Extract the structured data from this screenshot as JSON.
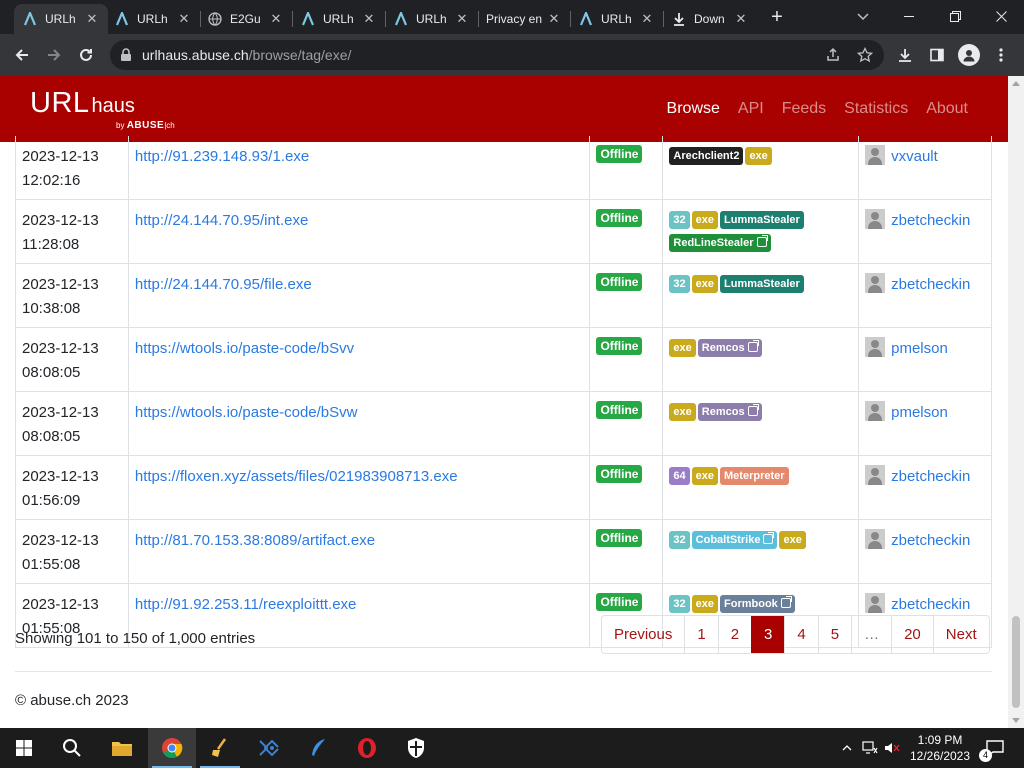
{
  "browser": {
    "tabs": [
      {
        "title": "URLh",
        "active": true
      },
      {
        "title": "URLh",
        "active": false
      },
      {
        "title": "E2Gu",
        "active": false
      },
      {
        "title": "URLh",
        "active": false
      },
      {
        "title": "URLh",
        "active": false
      },
      {
        "title": "Privacy en",
        "active": false
      },
      {
        "title": "URLh",
        "active": false
      },
      {
        "title": "Down",
        "active": false
      }
    ],
    "url_host": "urlhaus.abuse.ch",
    "url_path": "/browse/tag/exe/"
  },
  "site": {
    "brand_url": "URL",
    "brand_haus": "haus",
    "brand_by": "by",
    "brand_abuse": "ABUSE",
    "brand_ch": "ch",
    "nav": [
      {
        "label": "Browse",
        "active": true
      },
      {
        "label": "API",
        "active": false
      },
      {
        "label": "Feeds",
        "active": false
      },
      {
        "label": "Statistics",
        "active": false
      },
      {
        "label": "About",
        "active": false
      }
    ]
  },
  "rows": [
    {
      "date": "2023-12-13",
      "time": "12:02:16",
      "url": "http://91.239.148.93/1.exe",
      "status": "Offline",
      "tags": [
        {
          "t": "Arechclient2",
          "c": "b-arch",
          "ext": false
        },
        {
          "t": "exe",
          "c": "b-exe",
          "ext": false
        }
      ],
      "reporter": "vxvault"
    },
    {
      "date": "2023-12-13",
      "time": "11:28:08",
      "url": "http://24.144.70.95/int.exe",
      "status": "Offline",
      "tags": [
        {
          "t": "32",
          "c": "b-32",
          "ext": false
        },
        {
          "t": "exe",
          "c": "b-exe",
          "ext": false
        },
        {
          "t": "LummaStealer",
          "c": "b-lumma",
          "ext": false
        },
        {
          "t": "RedLineStealer",
          "c": "b-redline",
          "ext": true
        }
      ],
      "reporter": "zbetcheckin"
    },
    {
      "date": "2023-12-13",
      "time": "10:38:08",
      "url": "http://24.144.70.95/file.exe",
      "status": "Offline",
      "tags": [
        {
          "t": "32",
          "c": "b-32",
          "ext": false
        },
        {
          "t": "exe",
          "c": "b-exe",
          "ext": false
        },
        {
          "t": "LummaStealer",
          "c": "b-lumma",
          "ext": false
        }
      ],
      "reporter": "zbetcheckin"
    },
    {
      "date": "2023-12-13",
      "time": "08:08:05",
      "url": "https://wtools.io/paste-code/bSvv",
      "status": "Offline",
      "tags": [
        {
          "t": "exe",
          "c": "b-exe",
          "ext": false
        },
        {
          "t": "Remcos",
          "c": "b-remcos",
          "ext": true
        }
      ],
      "reporter": "pmelson"
    },
    {
      "date": "2023-12-13",
      "time": "08:08:05",
      "url": "https://wtools.io/paste-code/bSvw",
      "status": "Offline",
      "tags": [
        {
          "t": "exe",
          "c": "b-exe",
          "ext": false
        },
        {
          "t": "Remcos",
          "c": "b-remcos",
          "ext": true
        }
      ],
      "reporter": "pmelson"
    },
    {
      "date": "2023-12-13",
      "time": "01:56:09",
      "url": "https://floxen.xyz/assets/files/021983908713.exe",
      "status": "Offline",
      "tags": [
        {
          "t": "64",
          "c": "b-64",
          "ext": false
        },
        {
          "t": "exe",
          "c": "b-exe",
          "ext": false
        },
        {
          "t": "Meterpreter",
          "c": "b-meter",
          "ext": false
        }
      ],
      "reporter": "zbetcheckin"
    },
    {
      "date": "2023-12-13",
      "time": "01:55:08",
      "url": "http://81.70.153.38:8089/artifact.exe",
      "status": "Offline",
      "tags": [
        {
          "t": "32",
          "c": "b-32",
          "ext": false
        },
        {
          "t": "CobaltStrike",
          "c": "b-cobalt",
          "ext": true
        },
        {
          "t": "exe",
          "c": "b-exe",
          "ext": false
        }
      ],
      "reporter": "zbetcheckin"
    },
    {
      "date": "2023-12-13",
      "time": "01:55:08",
      "url": "http://91.92.253.11/reexploittt.exe",
      "status": "Offline",
      "tags": [
        {
          "t": "32",
          "c": "b-32",
          "ext": false
        },
        {
          "t": "exe",
          "c": "b-exe",
          "ext": false
        },
        {
          "t": "Formbook",
          "c": "b-form",
          "ext": true
        }
      ],
      "reporter": "zbetcheckin"
    }
  ],
  "entries_info": "Showing 101 to 150 of 1,000 entries",
  "pagination": [
    {
      "label": "Previous",
      "state": "normal"
    },
    {
      "label": "1",
      "state": "normal"
    },
    {
      "label": "2",
      "state": "normal"
    },
    {
      "label": "3",
      "state": "current"
    },
    {
      "label": "4",
      "state": "normal"
    },
    {
      "label": "5",
      "state": "normal"
    },
    {
      "label": "…",
      "state": "disabled"
    },
    {
      "label": "20",
      "state": "normal"
    },
    {
      "label": "Next",
      "state": "normal"
    }
  ],
  "footer": "© abuse.ch 2023",
  "taskbar": {
    "time": "1:09 PM",
    "date": "12/26/2023",
    "notifications": "4"
  },
  "colors": {
    "brand_red": "#a90000",
    "offline_green": "#28a745",
    "link_blue": "#2a7ae2"
  }
}
